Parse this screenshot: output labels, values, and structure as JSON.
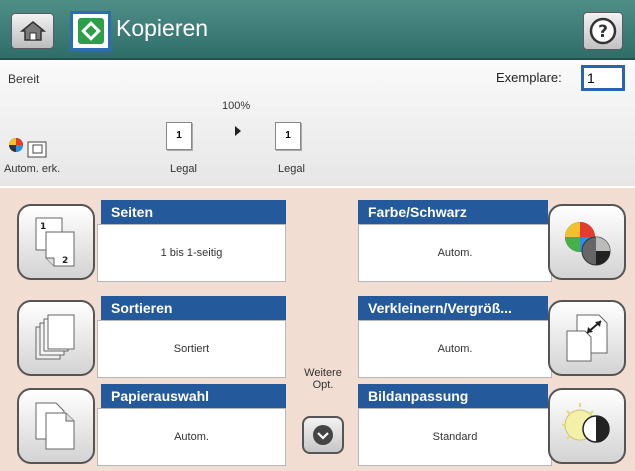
{
  "header": {
    "title": "Kopieren",
    "color": "#2f6d69",
    "home_icon": "home-icon",
    "app_icon": "copy-start-icon",
    "help_icon": "help-icon"
  },
  "status": {
    "ready_text": "Bereit",
    "copies_label": "Exemplare:",
    "copies_value": "1",
    "color_mode_label": "Autom. erk.",
    "zoom": "100%",
    "source_paper": {
      "count": "1",
      "label": "Legal"
    },
    "output_paper": {
      "count": "1",
      "label": "Legal"
    }
  },
  "options": {
    "sides": {
      "title": "Seiten",
      "value": "1 bis 1-seitig",
      "icon": "duplex-pages-icon"
    },
    "collate": {
      "title": "Sortieren",
      "value": "Sortiert",
      "icon": "collate-icon"
    },
    "paper": {
      "title": "Papierauswahl",
      "value": "Autom.",
      "icon": "paper-select-icon"
    },
    "color": {
      "title": "Farbe/Schwarz",
      "value": "Autom.",
      "icon": "color-black-icon"
    },
    "reduce_enlarge": {
      "title": "Verkleinern/Vergröß...",
      "value": "Autom.",
      "icon": "reduce-enlarge-icon"
    },
    "image_adjust": {
      "title": "Bildanpassung",
      "value": "Standard",
      "icon": "image-adjust-icon"
    }
  },
  "more_options": {
    "label_line1": "Weitere",
    "label_line2": "Opt.",
    "icon": "chevron-down-icon"
  },
  "colors": {
    "title_bar": "#24599b",
    "panel_bg": "#f1ddd1",
    "accent": "#2a64b0"
  }
}
